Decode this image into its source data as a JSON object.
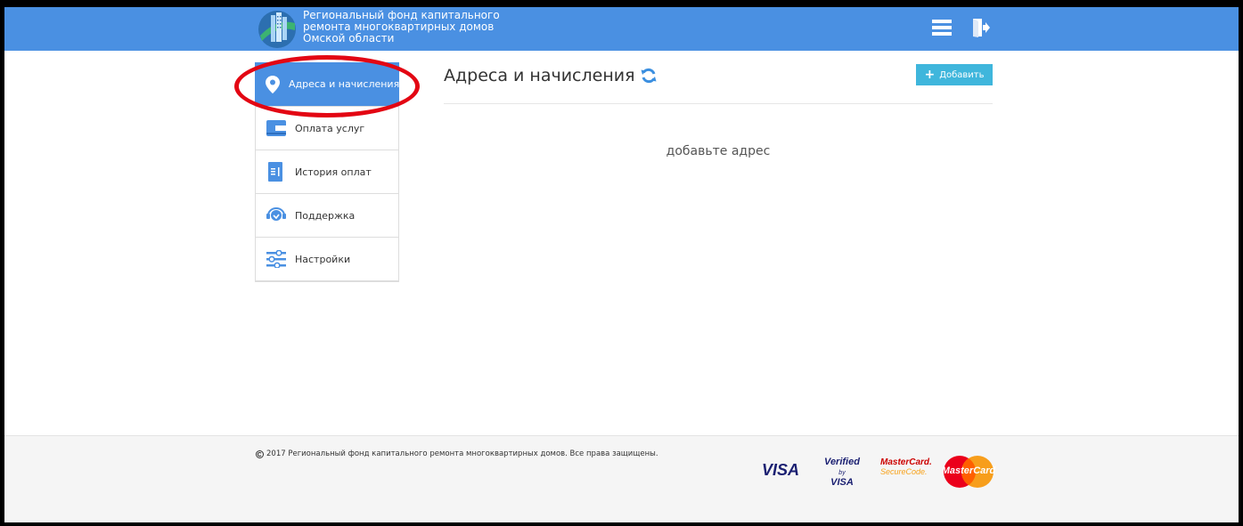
{
  "header": {
    "org_name_lines": [
      "Региональный фонд капитального",
      "ремонта многоквартирных домов",
      "Омской области"
    ],
    "icons": [
      "logo-icon",
      "menu-icon",
      "logout-icon"
    ]
  },
  "sidebar": {
    "items": [
      {
        "label": "Адреса и начисления",
        "icon": "location-pin-icon",
        "active": true
      },
      {
        "label": "Оплата услуг",
        "icon": "wallet-icon",
        "active": false
      },
      {
        "label": "История оплат",
        "icon": "document-icon",
        "active": false
      },
      {
        "label": "Поддержка",
        "icon": "support-icon",
        "active": false
      },
      {
        "label": "Настройки",
        "icon": "sliders-icon",
        "active": false
      }
    ]
  },
  "main": {
    "title": "Адреса и начисления",
    "add_button_label": "Добавить",
    "empty_message": "добавьте адрес"
  },
  "footer": {
    "copyright": "2017 Региональный фонд капитального ремонта многоквартирных домов. Все права защищены.",
    "payment_logos": {
      "visa": "VISA",
      "verified_by_visa_1": "Verified",
      "verified_by_visa_by": "by",
      "verified_by_visa_2": "VISA",
      "mastercard_securecode_1": "MasterCard.",
      "mastercard_securecode_2": "SecureCode.",
      "mastercard": "MasterCard"
    }
  },
  "colors": {
    "header_bg": "#4a90e2",
    "active_item_bg": "#4a90e2",
    "add_button_bg": "#3fb6dc",
    "highlight_oval": "#e30613",
    "footer_bg": "#f5f5f5"
  }
}
